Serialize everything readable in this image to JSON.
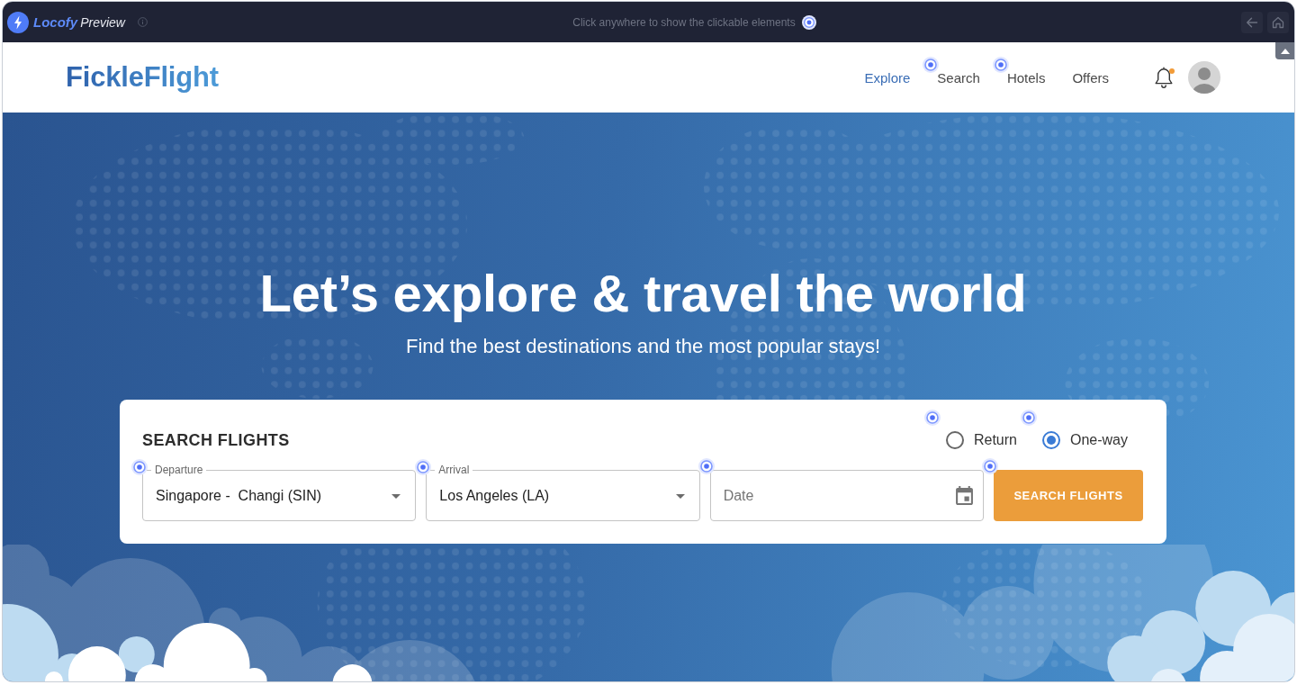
{
  "preview_bar": {
    "brand": "Locofy",
    "label": "Preview",
    "hint": "Click anywhere to show the clickable elements"
  },
  "header": {
    "logo": "FickleFlight",
    "nav": [
      {
        "label": "Explore",
        "selected": true,
        "hotspot": false
      },
      {
        "label": "Search",
        "selected": false,
        "hotspot": true
      },
      {
        "label": "Hotels",
        "selected": false,
        "hotspot": true
      },
      {
        "label": "Offers",
        "selected": false,
        "hotspot": false
      }
    ],
    "notifications": {
      "unread": true
    }
  },
  "hero": {
    "title": "Let’s explore & travel the world",
    "subtitle": "Find the best destinations and the most popular stays!"
  },
  "search": {
    "title": "SEARCH FLIGHTS",
    "trip_types": [
      {
        "label": "Return",
        "selected": false,
        "hotspot": true
      },
      {
        "label": "One-way",
        "selected": true,
        "hotspot": true
      }
    ],
    "fields": [
      {
        "kind": "select",
        "label": "Departure",
        "value": "Singapore -  Changi (SIN)",
        "hotspot": true
      },
      {
        "kind": "select",
        "label": "Arrival",
        "value": "Los Angeles (LA)",
        "hotspot": true
      },
      {
        "kind": "date",
        "placeholder": "Date",
        "hotspot": true
      }
    ],
    "button": {
      "label": "SEARCH FLIGHTS",
      "hotspot": true
    }
  }
}
